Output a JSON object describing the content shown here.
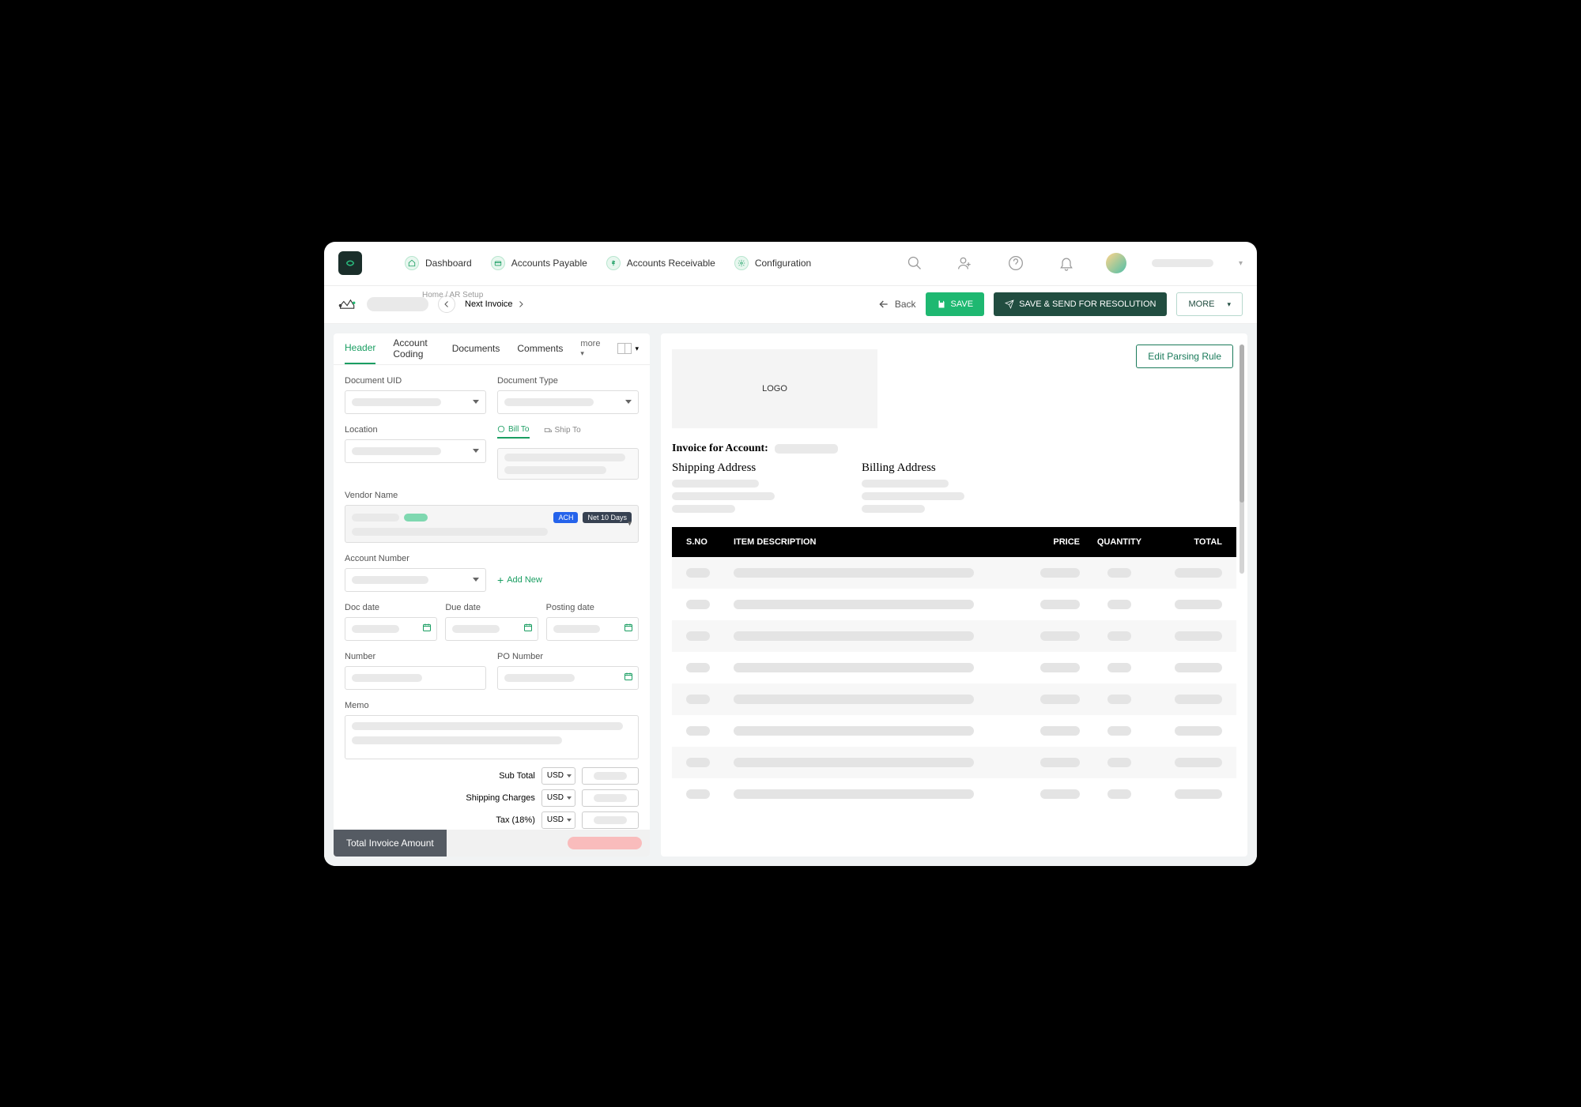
{
  "header": {
    "nav": [
      "Dashboard",
      "Accounts Payable",
      "Accounts Receivable",
      "Configuration"
    ]
  },
  "secondary": {
    "breadcrumb_home": "Home",
    "breadcrumb_page": "AR Setup",
    "next_invoice": "Next Invoice",
    "back": "Back",
    "save": "SAVE",
    "save_send": "SAVE & SEND FOR RESOLUTION",
    "more": "MORE"
  },
  "left_panel": {
    "tabs": [
      "Header",
      "Account Coding",
      "Documents",
      "Comments"
    ],
    "more_tab": "more",
    "fields": {
      "document_uid": "Document UID",
      "document_type": "Document Type",
      "location": "Location",
      "bill_to": "Bill To",
      "ship_to": "Ship To",
      "vendor_name": "Vendor Name",
      "ach": "ACH",
      "net10": "Net 10 Days",
      "account_number": "Account Number",
      "add_new": "Add New",
      "doc_date": "Doc date",
      "due_date": "Due date",
      "posting_date": "Posting date",
      "number": "Number",
      "po_number": "PO Number",
      "memo": "Memo",
      "sub_total": "Sub Total",
      "shipping_charges": "Shipping Charges",
      "tax": "Tax (18%)",
      "currency": "USD",
      "total_invoice": "Total Invoice Amount"
    }
  },
  "right_panel": {
    "edit_rule": "Edit Parsing Rule",
    "logo": "LOGO",
    "invoice_for": "Invoice for Account:",
    "shipping_addr": "Shipping Address",
    "billing_addr": "Billing Address",
    "cols": {
      "sno": "S.NO",
      "desc": "ITEM DESCRIPTION",
      "price": "PRICE",
      "qty": "QUANTITY",
      "total": "TOTAL"
    }
  }
}
